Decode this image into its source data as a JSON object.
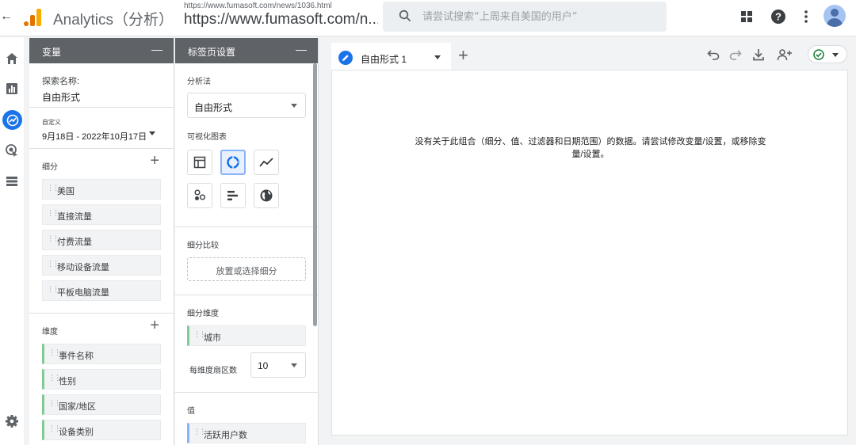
{
  "topbar": {
    "app_title": "Analytics（分析）",
    "url_small": "https://www.fumasoft.com/news/1036.html",
    "url_big": "https://www.fumasoft.com/n...",
    "search_placeholder": "请尝试搜索“上周来自美国的用户”"
  },
  "variables_panel": {
    "header": "变量",
    "exploration_name_label": "探索名称:",
    "exploration_name": "自由形式",
    "date_label": "自定义",
    "date_range": "9月18日 - 2022年10月17日",
    "segments_title": "细分",
    "segments": [
      "美国",
      "直接流量",
      "付费流量",
      "移动设备流量",
      "平板电脑流量"
    ],
    "dimensions_title": "维度",
    "dimensions": [
      "事件名称",
      "性别",
      "国家/地区",
      "设备类别"
    ]
  },
  "tab_settings_panel": {
    "header": "标签页设置",
    "technique_label": "分析法",
    "technique_value": "自由形式",
    "visualization_label": "可视化图表",
    "segment_compare_label": "细分比较",
    "segment_drop_placeholder": "放置或选择细分",
    "segment_dimension_label": "细分维度",
    "segment_dimension_chip": "城市",
    "rows_per_dimension_label": "每维度扇区数",
    "rows_per_dimension_value": "10",
    "values_label": "值",
    "values_chip": "活跃用户数"
  },
  "canvas": {
    "tab_label": "自由形式 1",
    "empty_message": "没有关于此组合（细分、值、过滤器和日期范围）的数据。请尝试修改变量/设置，或移除变量/设置。"
  },
  "colors": {
    "accent": "#1a73e8",
    "panel_header": "#5f6368",
    "dimension_chip_border": "#81c995",
    "metric_chip_border": "#8ab4f8"
  }
}
